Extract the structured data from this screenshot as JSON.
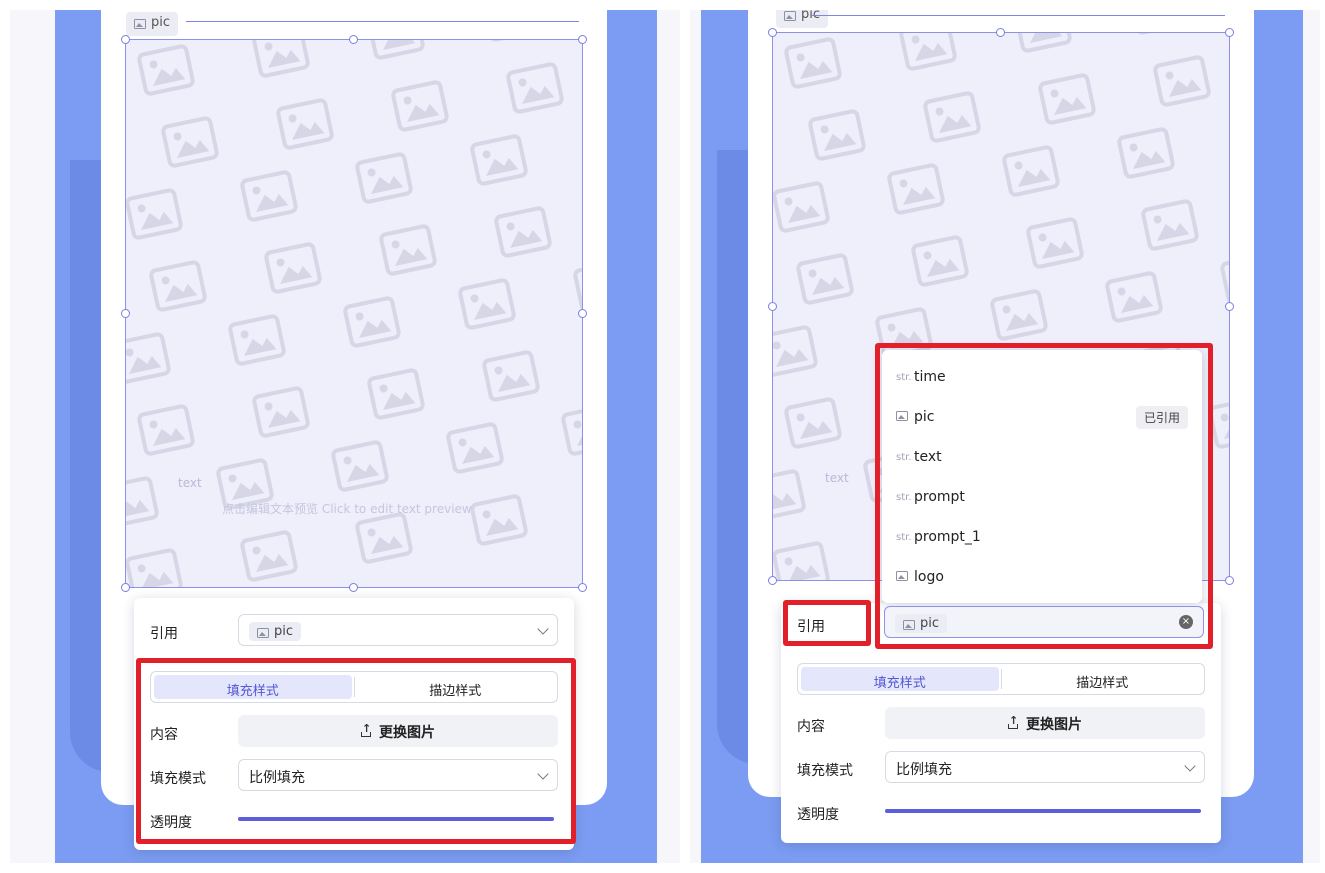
{
  "left": {
    "canvas": {
      "layer_tag": "pic",
      "ghost_text_tag": "text",
      "ghost_caption": "点击编辑文本预览 Click to edit text preview"
    },
    "panel": {
      "reference_label": "引用",
      "reference_value": "pic",
      "tab_fill": "填充样式",
      "tab_stroke": "描边样式",
      "content_label": "内容",
      "replace_button": "更换图片",
      "fill_mode_label": "填充模式",
      "fill_mode_value": "比例填充",
      "opacity_label": "透明度",
      "opacity_value": 1
    }
  },
  "right": {
    "canvas": {
      "layer_tag": "pic",
      "ghost_text_tag": "text"
    },
    "dropdown": {
      "items": [
        {
          "type": "str.",
          "label": "time",
          "badge": ""
        },
        {
          "type": "image",
          "label": "pic",
          "badge": "已引用"
        },
        {
          "type": "str.",
          "label": "text",
          "badge": ""
        },
        {
          "type": "str.",
          "label": "prompt",
          "badge": ""
        },
        {
          "type": "str.",
          "label": "prompt_1",
          "badge": ""
        },
        {
          "type": "image",
          "label": "logo",
          "badge": ""
        }
      ],
      "selected_value": "pic"
    },
    "panel": {
      "reference_label": "引用",
      "tab_fill": "填充样式",
      "tab_stroke": "描边样式",
      "content_label": "内容",
      "replace_button": "更换图片",
      "fill_mode_label": "填充模式",
      "fill_mode_value": "比例填充",
      "opacity_label": "透明度",
      "opacity_value": 1
    }
  },
  "colors": {
    "accent": "#5a5ed8",
    "highlight_box": "#e1202a",
    "poster_blue": "#7b9cf2"
  },
  "icons": {
    "watermark": "image-placeholder-icon",
    "type_string": "str.",
    "type_image": "image-icon",
    "upload": "upload-icon",
    "clear": "clear-circle-icon"
  }
}
